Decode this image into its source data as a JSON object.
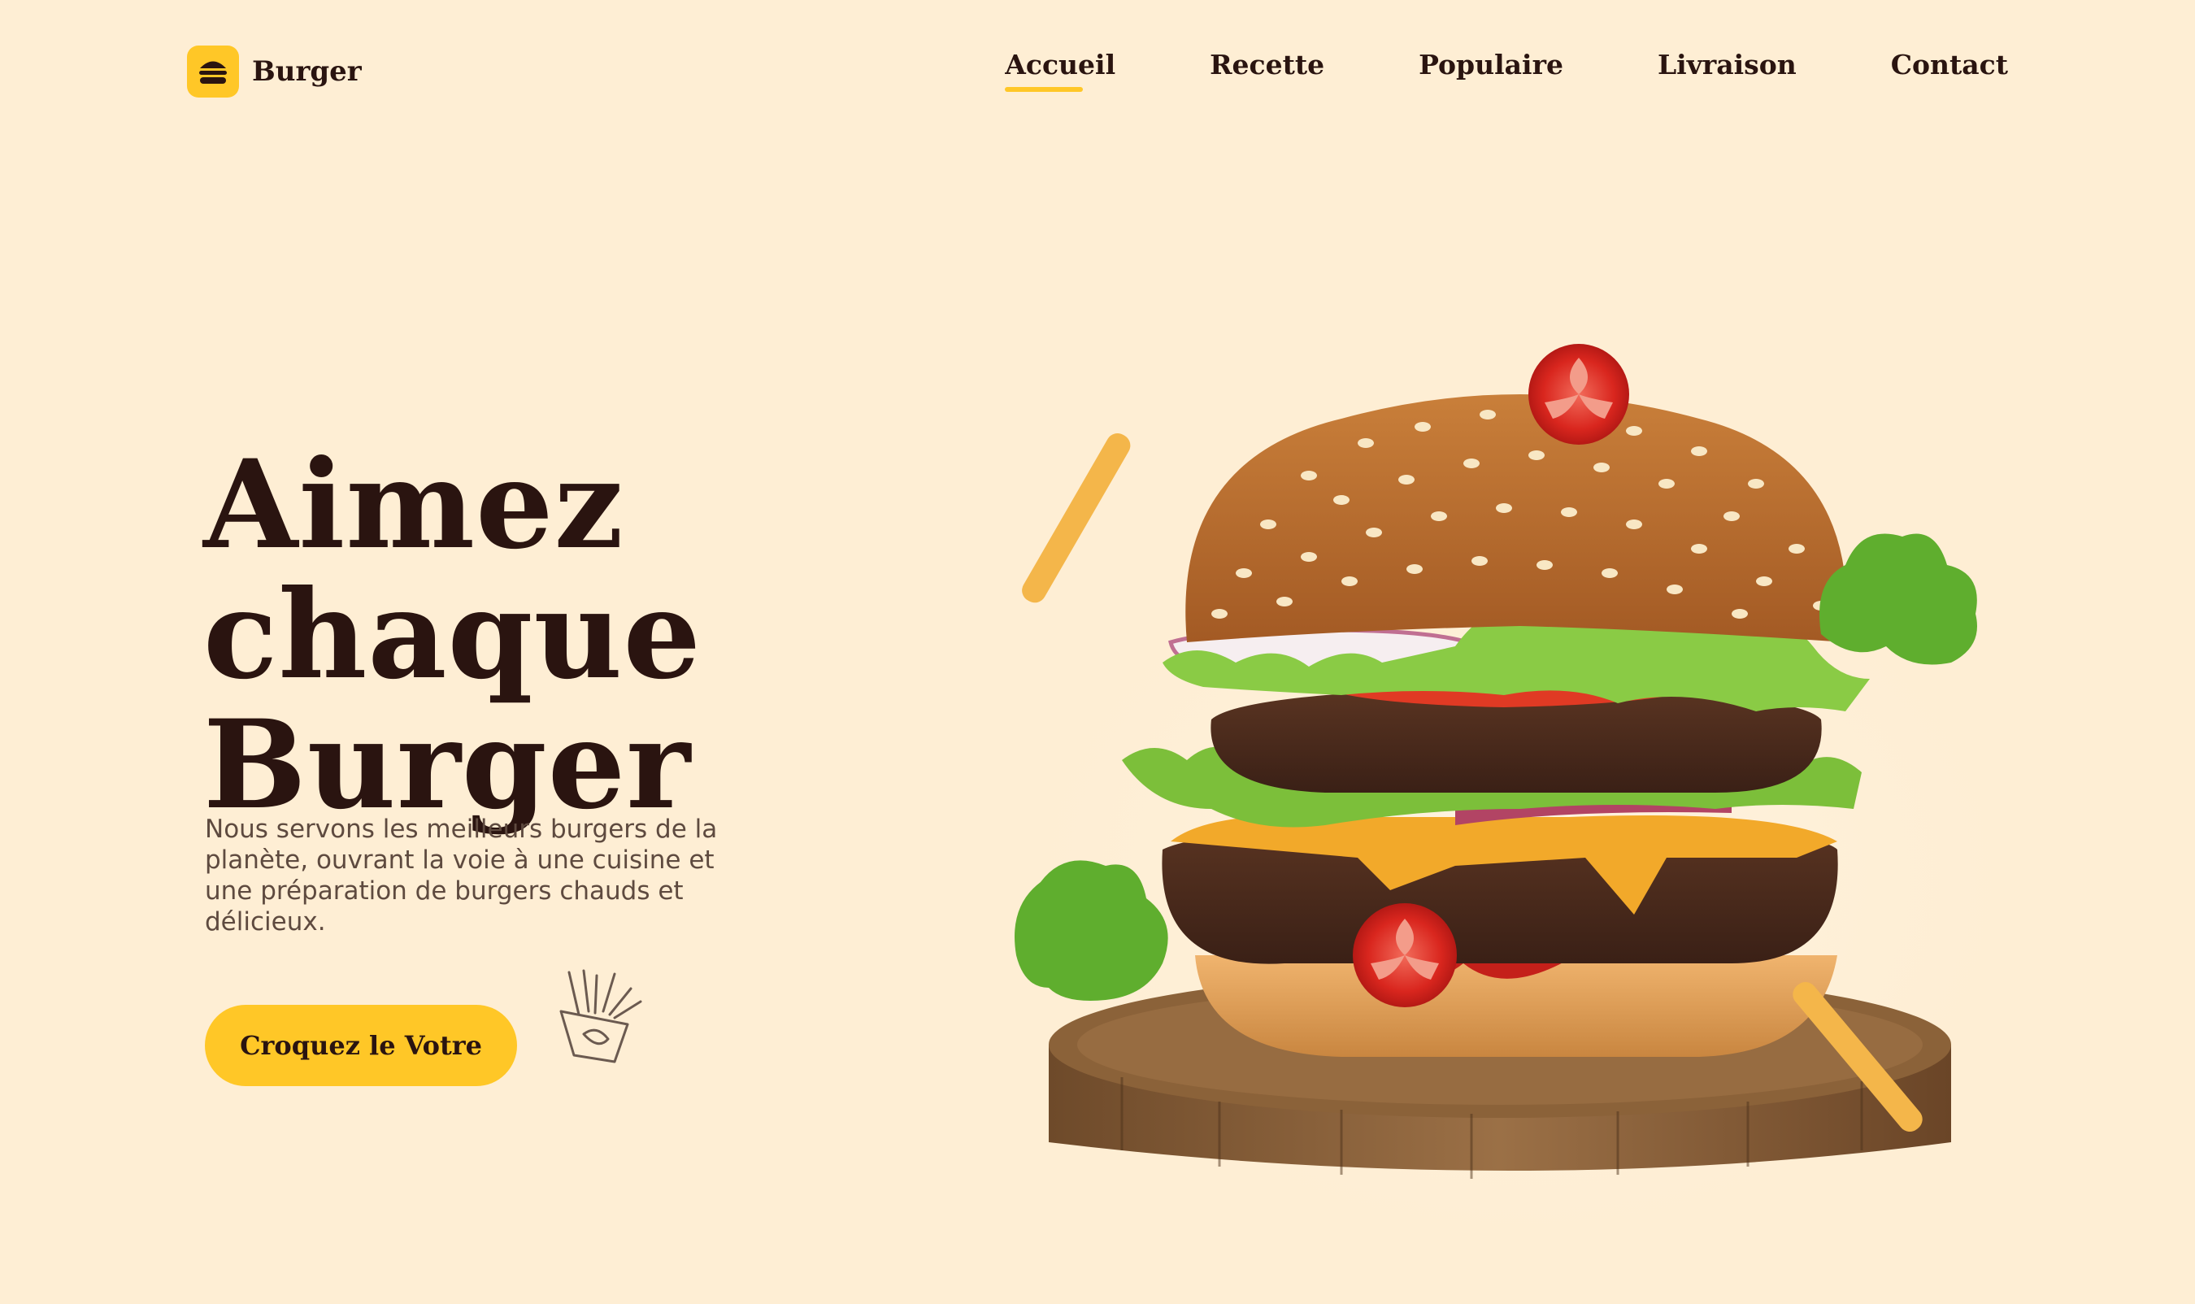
{
  "brand": {
    "name": "Burger",
    "icon": "burger-icon",
    "accent_color": "#FFC727"
  },
  "nav": {
    "items": [
      {
        "label": "Accueil",
        "active": true
      },
      {
        "label": "Recette",
        "active": false
      },
      {
        "label": "Populaire",
        "active": false
      },
      {
        "label": "Livraison",
        "active": false
      },
      {
        "label": "Contact",
        "active": false
      }
    ]
  },
  "hero": {
    "title_lines": [
      "Aimez",
      "chaque",
      "Burger"
    ],
    "description": "Nous servons les meilleurs burgers de la planète, ouvrant la voie à une cuisine et une préparation de burgers chauds et délicieux.",
    "cta_label": "Croquez le Votre",
    "decor_icon": "fries-icon",
    "image": "burger-on-wooden-board"
  },
  "colors": {
    "background": "#FEEED4",
    "text": "#2A1410",
    "accent": "#FFC727"
  }
}
